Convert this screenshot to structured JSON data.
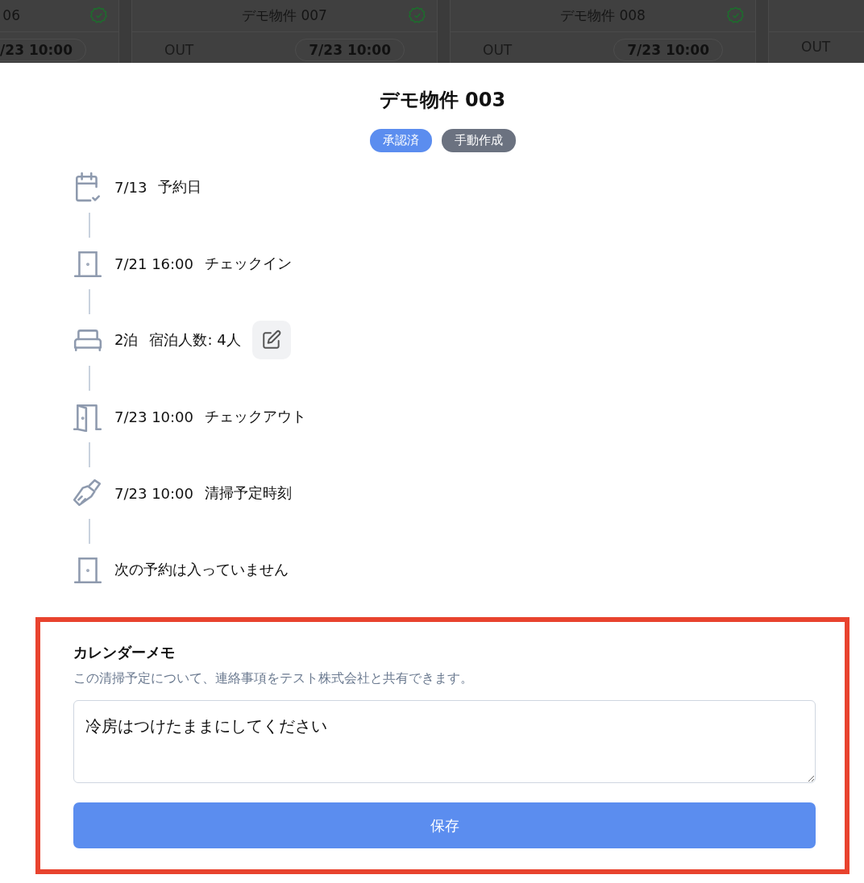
{
  "background_cards": [
    {
      "title": "06",
      "verified": true,
      "time": "/23 10:00"
    },
    {
      "title": "デモ物件 007",
      "verified": true,
      "direction": "OUT",
      "time": "7/23 10:00"
    },
    {
      "title": "デモ物件 008",
      "verified": true,
      "direction": "OUT",
      "time": "7/23 10:00"
    },
    {
      "direction": "OUT"
    }
  ],
  "modal": {
    "title": "デモ物件 003",
    "badges": [
      {
        "label": "承認済",
        "color": "#5b8def"
      },
      {
        "label": "手動作成",
        "color": "#6b7280"
      }
    ],
    "timeline": [
      {
        "kind": "reserved",
        "time": "7/13",
        "label": "予約日"
      },
      {
        "kind": "checkin",
        "time": "7/21 16:00",
        "label": "チェックイン"
      },
      {
        "kind": "stay",
        "time": "2泊",
        "label": "宿泊人数: 4人",
        "editable": true
      },
      {
        "kind": "checkout",
        "time": "7/23 10:00",
        "label": "チェックアウト"
      },
      {
        "kind": "cleaning",
        "time": "7/23 10:00",
        "label": "清掃予定時刻"
      },
      {
        "kind": "next",
        "label": "次の予約は入っていません"
      }
    ],
    "memo": {
      "highlighted": true,
      "label": "カレンダーメモ",
      "description": "この清掃予定について、連絡事項をテスト株式会社と共有できます。",
      "value": "冷房はつけたままにしてください",
      "save_button": "保存"
    }
  }
}
